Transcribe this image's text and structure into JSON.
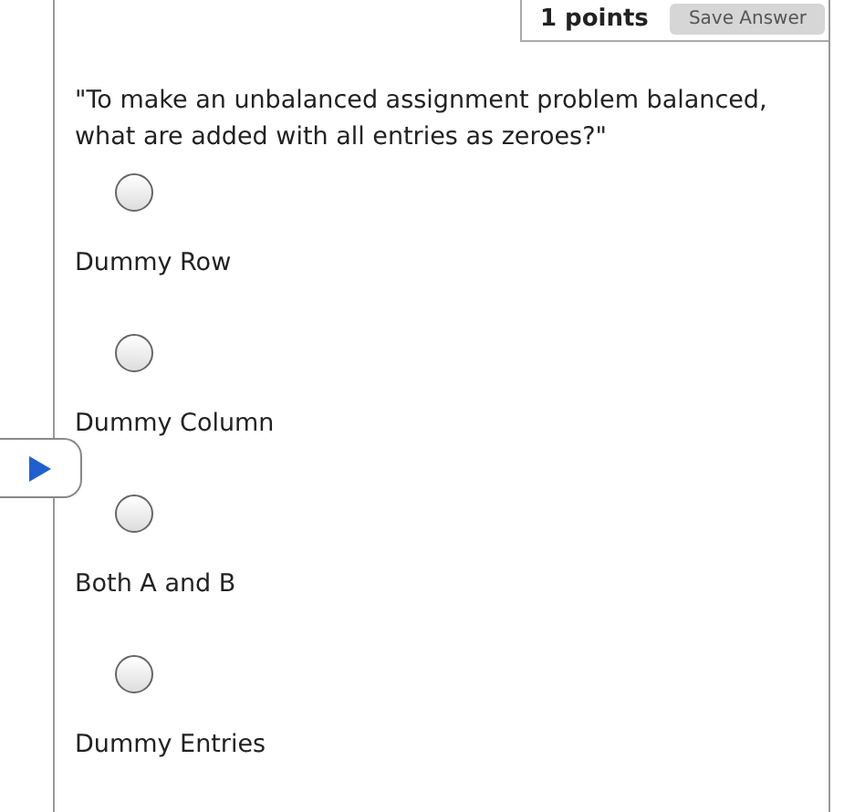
{
  "header": {
    "points": "1 points",
    "save_button": "Save Answer"
  },
  "question": "\"To make an unbalanced assignment problem balanced, what are added with all entries as zeroes?\"",
  "options": [
    {
      "label": "Dummy Row",
      "selected": false
    },
    {
      "label": "Dummy Column",
      "selected": false
    },
    {
      "label": "Both A and B",
      "selected": false
    },
    {
      "label": "Dummy Entries",
      "selected": false
    }
  ]
}
